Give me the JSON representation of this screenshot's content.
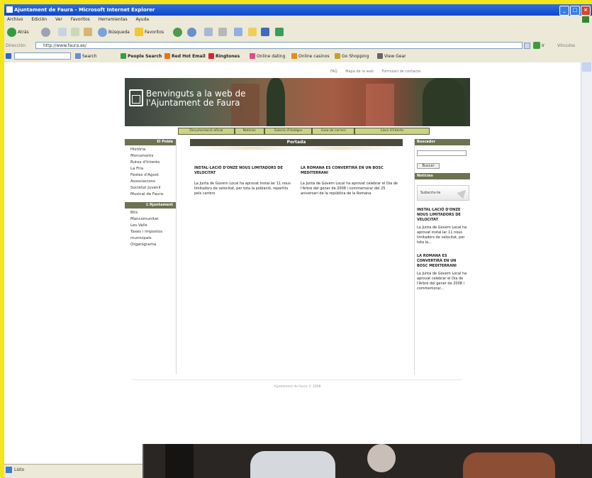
{
  "window": {
    "title": "Ajuntament de Faura - Microsoft Internet Explorer",
    "controls": [
      "_",
      "□",
      "×"
    ]
  },
  "menubar": [
    "Archivo",
    "Edición",
    "Ver",
    "Favoritos",
    "Herramientas",
    "Ayuda"
  ],
  "toolbar": {
    "back": "Atrás",
    "search": "Búsqueda",
    "favorites": "Favoritos"
  },
  "address": {
    "label": "Dirección",
    "url": "http://www.faura.es/",
    "go": "Ir",
    "links": "Vínculos"
  },
  "googlebar": {
    "search": "Search",
    "items": [
      "People Search",
      "Red Hot Email",
      "Ringtones",
      "Online dating",
      "Online casinos",
      "Go Shopping",
      "View Gear"
    ]
  },
  "status": {
    "text": "Listo"
  },
  "page": {
    "toplinks": [
      "FAQ",
      "Mapa de la web",
      "Formulari de contacte"
    ],
    "banner_title": "Benvinguts a la web de\nl'Ajuntament de Faura",
    "nav": [
      "Documentació oficial",
      "Notícies",
      "Galeria d'imatges",
      "Guia de carrers",
      "Llocs d'interès"
    ],
    "left": {
      "section1": "El Poble",
      "items1": [
        "Història",
        "Monuments",
        "Rutes d'Interès",
        "La Fira",
        "Festes d'Agost",
        "Associacions",
        "Societat Juvenil",
        "Musical de Faura"
      ],
      "section2": "L'Ajuntament",
      "items2": [
        "Bits",
        "Mancomunitat",
        "Les Valls",
        "Taxes i impostos",
        "municipals",
        "Organigrama"
      ]
    },
    "center": {
      "header": "Portada",
      "news": [
        {
          "title": "INSTAL·LACIÓ D'ONZE NOUS LIMITADORS DE VELOCITAT",
          "body": "La Junta de Govern Local ha aprovat instal·lar 11 nous limitadors de velocitat, per tota la població, repartits pels carrers"
        },
        {
          "title": "LA ROMANA ES CONVERTIRÀ EN UN BOSC MEDITERRANI",
          "body": "La Junta de Govern Local ha aprovat celebrar el Dia de l'Arbre del gener de 2008 i commemorar del 25 aniversari de la república de la Romana"
        }
      ]
    },
    "right": {
      "search_header": "Buscador",
      "search_placeholder": "",
      "search_button": "Buscar",
      "news_header": "Notícies",
      "subscribe": "Subscriu-te",
      "items": [
        {
          "title": "INSTAL·LACIÓ D'ONZE NOUS LIMITADORS DE VELOCITAT",
          "body": "La Junta de Govern Local ha aprovat instal·lar 11 nous limitadors de velocitat, per tota la..."
        },
        {
          "title": "LA ROMANA ES CONVERTIRÀ EN UN BOSC MEDITERRANI",
          "body": "La Junta de Govern Local ha aprovat celebrar el Dia de l'Arbre del gener de 2008 i commemorar..."
        }
      ]
    },
    "footer": "Ajuntament de Faura © 2008"
  },
  "colors": {
    "title_bar": "#1f5fd6",
    "nav_active": "#c9d48a",
    "section_header": "#6b7350",
    "page_frame": "#f4e41c"
  }
}
